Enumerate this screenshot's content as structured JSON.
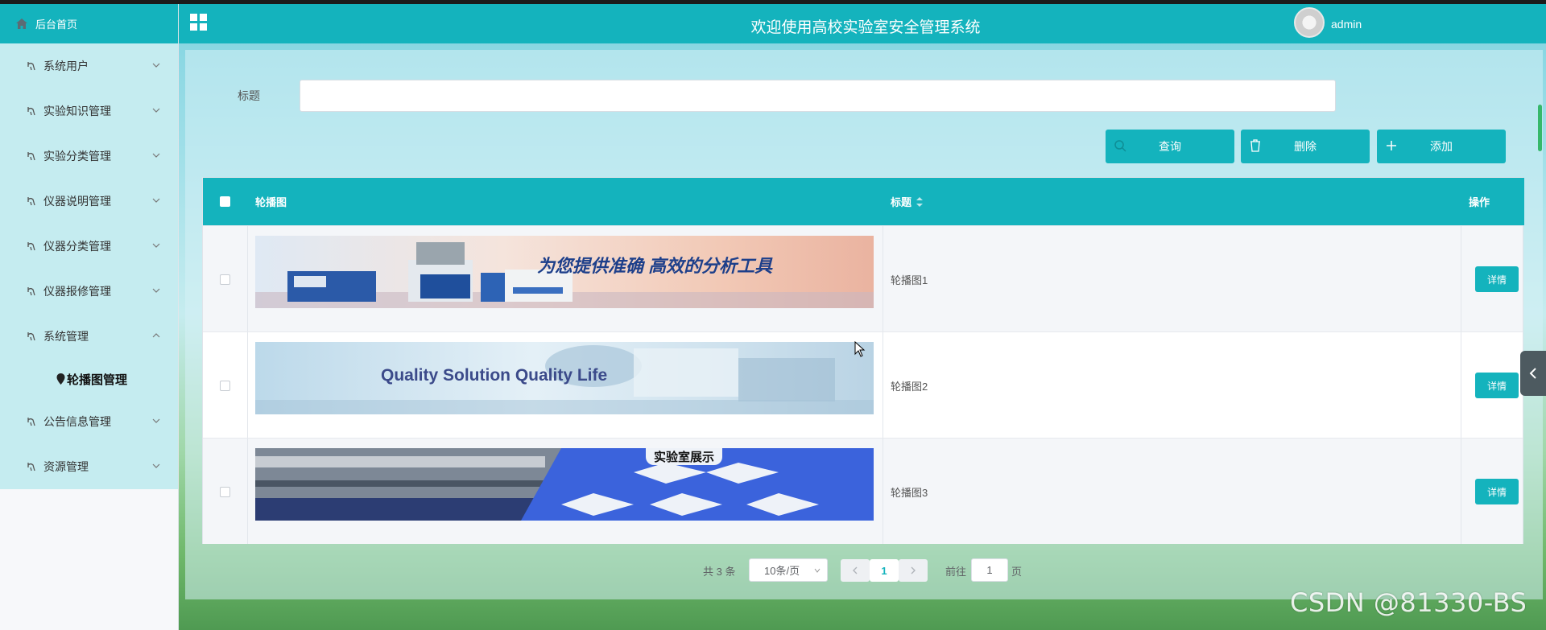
{
  "header": {
    "title": "欢迎使用高校实验室安全管理系统",
    "username": "admin"
  },
  "sidebar": {
    "home_label": "后台首页",
    "items": [
      {
        "label": "系统用户"
      },
      {
        "label": "实验知识管理"
      },
      {
        "label": "实验分类管理"
      },
      {
        "label": "仪器说明管理"
      },
      {
        "label": "仪器分类管理"
      },
      {
        "label": "仪器报修管理"
      },
      {
        "label": "系统管理",
        "expanded": true
      },
      {
        "label": "公告信息管理"
      },
      {
        "label": "资源管理"
      }
    ],
    "submenu": {
      "label": "轮播图管理"
    }
  },
  "search": {
    "label": "标题",
    "value": "",
    "placeholder": ""
  },
  "toolbar": {
    "query_label": "查询",
    "delete_label": "删除",
    "add_label": "添加"
  },
  "table": {
    "headers": {
      "image": "轮播图",
      "title": "标题",
      "action": "操作"
    },
    "rows": [
      {
        "title": "轮播图1",
        "action": "详情",
        "banner_text": "为您提供准确 高效的分析工具"
      },
      {
        "title": "轮播图2",
        "action": "详情",
        "banner_text": "Quality Solution  Quality Life"
      },
      {
        "title": "轮播图3",
        "action": "详情",
        "banner_text": "实验室展示"
      }
    ]
  },
  "pagination": {
    "total": "共 3 条",
    "page_size": "10条/页",
    "current": "1",
    "goto_label": "前往",
    "goto_value": "1",
    "page_suffix": "页"
  },
  "watermark": "CSDN @81330-BS",
  "colors": {
    "accent": "#14b3bd",
    "sidebar_bg": "#c5ecf0"
  }
}
